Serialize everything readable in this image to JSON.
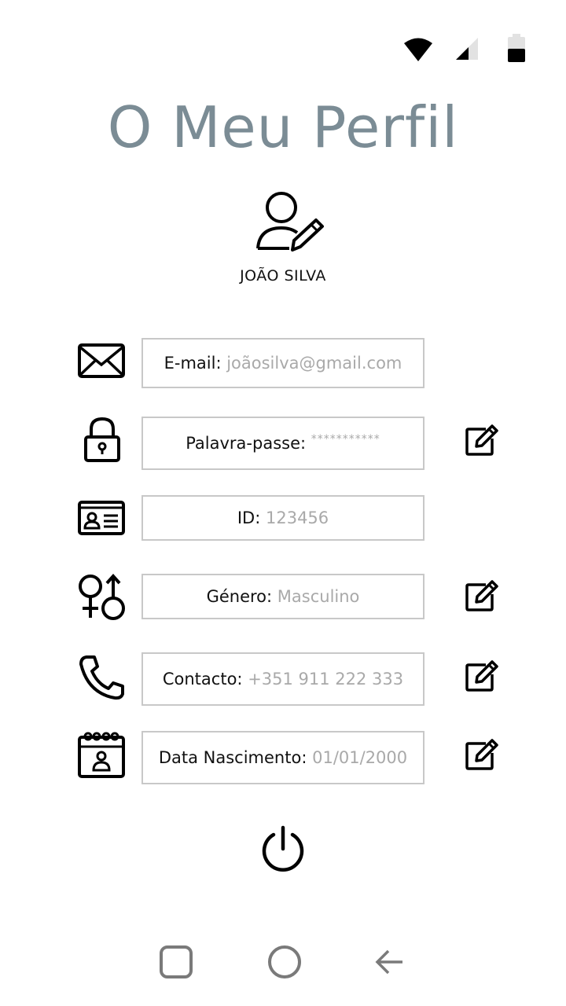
{
  "status_bar": {
    "icons": [
      "wifi-icon",
      "signal-icon",
      "battery-icon"
    ]
  },
  "page": {
    "title": "O Meu Perfil"
  },
  "user": {
    "name": "JOÃO SILVA",
    "avatar_icon": "user-edit-icon"
  },
  "fields": [
    {
      "icon": "envelope-icon",
      "label": "E-mail:",
      "value": "joãosilva@gmail.com",
      "editable": false
    },
    {
      "icon": "lock-icon",
      "label": "Palavra-passe:",
      "value": "***********",
      "editable": true
    },
    {
      "icon": "id-card-icon",
      "label": "ID:",
      "value": "123456",
      "editable": false
    },
    {
      "icon": "gender-icon",
      "label": "Género:",
      "value": "Masculino",
      "editable": true
    },
    {
      "icon": "phone-icon",
      "label": "Contacto:",
      "value": "+351 911 222 333",
      "editable": true
    },
    {
      "icon": "calendar-icon",
      "label": "Data Nascimento:",
      "value": "01/01/2000",
      "editable": true
    }
  ],
  "actions": {
    "logout_icon": "power-icon"
  },
  "nav_bar": {
    "icons": [
      "recent-apps-icon",
      "home-icon",
      "back-icon"
    ]
  }
}
